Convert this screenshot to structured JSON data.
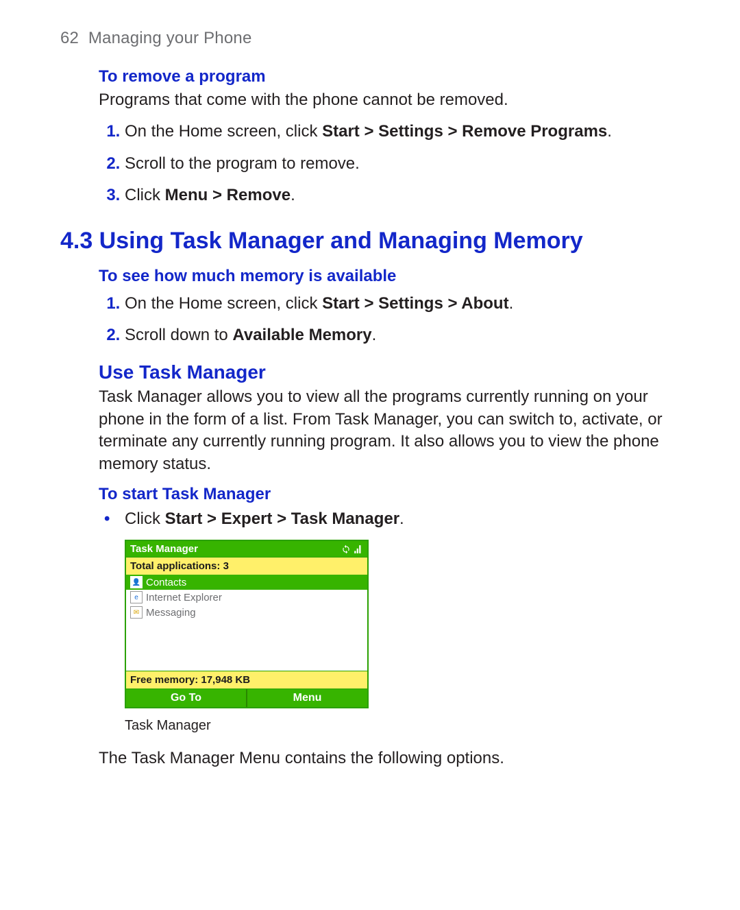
{
  "header": {
    "page_number": "62",
    "section_title": "Managing your Phone"
  },
  "remove_program": {
    "heading": "To remove a program",
    "intro": "Programs that come with the phone cannot be removed.",
    "steps": [
      {
        "pre": "On the Home screen, click ",
        "bold": "Start > Settings > Remove Programs",
        "post": "."
      },
      {
        "pre": "Scroll to the program to remove.",
        "bold": "",
        "post": ""
      },
      {
        "pre": "Click ",
        "bold": "Menu > Remove",
        "post": "."
      }
    ]
  },
  "section43": {
    "heading": "4.3 Using Task Manager and Managing Memory",
    "memory_heading": "To see how much memory is available",
    "memory_steps": [
      {
        "pre": "On the Home screen, click ",
        "bold": "Start > Settings > About",
        "post": "."
      },
      {
        "pre": "Scroll down to ",
        "bold": "Available Memory",
        "post": "."
      }
    ]
  },
  "task_manager": {
    "sub_heading": "Use Task Manager",
    "description": "Task Manager allows you to view all the programs currently running on your phone in the form of a list. From Task Manager, you can switch to, activate, or terminate any currently running program. It also allows you to view the phone memory status.",
    "start_heading": "To start Task Manager",
    "start_bullet_pre": "Click ",
    "start_bullet_bold": "Start > Expert > Task Manager",
    "start_bullet_post": "."
  },
  "screenshot": {
    "title": "Task Manager",
    "total_apps": "Total applications: 3",
    "apps": [
      {
        "name": "Contacts",
        "selected": true
      },
      {
        "name": "Internet Explorer",
        "selected": false
      },
      {
        "name": "Messaging",
        "selected": false
      }
    ],
    "free_memory": "Free memory: 17,948 KB",
    "softkey_left": "Go To",
    "softkey_right": "Menu",
    "caption": "Task Manager"
  },
  "outro": "The Task Manager Menu contains the following options."
}
